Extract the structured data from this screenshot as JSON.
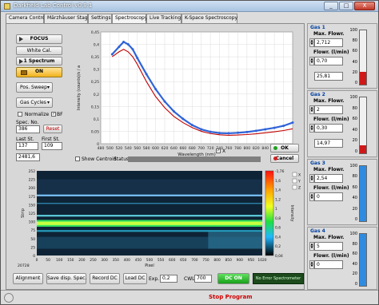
{
  "window": {
    "title": "Darkfield Lab Control v0.8.1",
    "min": "_",
    "max": "□",
    "close": "X"
  },
  "tabs": [
    {
      "label": "Camera Control"
    },
    {
      "label": "Märzhäuser Stage"
    },
    {
      "label": "Settings"
    },
    {
      "label": "Spectroscopy"
    },
    {
      "label": "Live Tracking"
    },
    {
      "label": "K-Space Spectroscopy"
    }
  ],
  "left": {
    "focus": "FOCUS",
    "white_cal": "White Cal.",
    "one_spectrum": "1 Spectrum",
    "on": "ON",
    "pos_sweep": "Pos. Sweep",
    "gas_cycles": "Gas Cycles",
    "normalize": "Normalize",
    "bf": "BF",
    "spec_no_label": "Spec. No.",
    "spec_no": "386",
    "reset": "Reset",
    "last_st_label": "Last St.",
    "first_st_label": "First St.",
    "last_st": "137",
    "first_st": "109",
    "value_2481": "2481,6"
  },
  "spectrum_plot": {
    "show_centroid": "Show Centroid",
    "status": "Status",
    "legend_x": "X",
    "ok": "OK",
    "cancel": "Cancel"
  },
  "chart_data": [
    {
      "type": "line",
      "xlabel": "Wavelength (nm)",
      "ylabel": "Intensity (counts)/s / a",
      "xlim": [
        480,
        900
      ],
      "ylim": [
        0,
        0.45
      ],
      "xticks": [
        "480",
        "500",
        "520",
        "540",
        "560",
        "580",
        "600",
        "620",
        "640",
        "660",
        "680",
        "700",
        "720",
        "740",
        "760",
        "780",
        "800",
        "820",
        "840",
        "860",
        "880",
        "900"
      ],
      "yticks": [
        "0,45",
        "0,4",
        "0,35",
        "0,3",
        "0,25",
        "0,2",
        "0,15",
        "0,1",
        "0,05",
        "0"
      ],
      "series": [
        {
          "color": "#2f63d8",
          "x": [
            505,
            520,
            530,
            540,
            550,
            560,
            580,
            600,
            620,
            640,
            660,
            680,
            700,
            720,
            740,
            760,
            780,
            800,
            820,
            840,
            860,
            880,
            900
          ],
          "y": [
            0.36,
            0.39,
            0.41,
            0.4,
            0.38,
            0.345,
            0.28,
            0.22,
            0.17,
            0.13,
            0.1,
            0.075,
            0.058,
            0.048,
            0.043,
            0.042,
            0.044,
            0.047,
            0.052,
            0.058,
            0.064,
            0.072,
            0.085
          ]
        },
        {
          "color": "#c00000",
          "x": [
            505,
            520,
            530,
            540,
            550,
            560,
            580,
            600,
            620,
            640,
            660,
            680,
            700,
            720,
            740,
            760,
            780,
            800,
            820,
            840,
            860,
            880,
            900
          ],
          "y": [
            0.35,
            0.37,
            0.38,
            0.37,
            0.35,
            0.32,
            0.25,
            0.19,
            0.145,
            0.11,
            0.085,
            0.065,
            0.05,
            0.041,
            0.036,
            0.034,
            0.035,
            0.037,
            0.04,
            0.044,
            0.048,
            0.053,
            0.06
          ]
        }
      ]
    },
    {
      "type": "heatmap",
      "xlabel": "Pixel",
      "ylabel": "Strip",
      "colorbar_label": "Intensity",
      "xticks": [
        "0",
        "50",
        "100",
        "150",
        "200",
        "250",
        "300",
        "350",
        "400",
        "450",
        "500",
        "550",
        "600",
        "650",
        "700",
        "750",
        "800",
        "850",
        "900",
        "950",
        "1020"
      ],
      "yticks": [
        "252",
        "225",
        "200",
        "175",
        "150",
        "125",
        "100",
        "75",
        "50",
        "25",
        "0"
      ],
      "colorbar_ticks": [
        "-1,76",
        "1,6",
        "1,4",
        "1,2",
        "1",
        "0,8",
        "0,6",
        "0,4",
        "0,2",
        "0,04"
      ],
      "bottom_left": "20728",
      "axis_labels": [
        "X",
        "Y",
        "Z"
      ]
    }
  ],
  "bottom": {
    "alignment": "Alignment",
    "save_disp": "Save disp. Spec.",
    "record_dc": "Record DC",
    "load_dc": "Load DC",
    "exp_t_label": "Exp. T",
    "exp_t": "0,2",
    "cwl_label": "CWL",
    "cwl": "700",
    "dc_on": "DC ON",
    "no_error": "No Error Spectrometer"
  },
  "gases": [
    {
      "title": "Gas 1",
      "max_label": "Max. Flowr.",
      "max": "2,712",
      "flow_label": "Flowr. (l/min)",
      "flow": "0,70",
      "value": "25,81",
      "scale": [
        "100",
        "80",
        "60",
        "40",
        "20",
        "0"
      ],
      "fill": 0.24,
      "fill_color": "#d01818"
    },
    {
      "title": "Gas 2",
      "max_label": "Max. Flowr.",
      "max": "2",
      "flow_label": "Flowr. (l/min)",
      "flow": "0,30",
      "value": "14,97",
      "scale": [
        "100",
        "80",
        "60",
        "40",
        "20",
        "0"
      ],
      "fill": 0.15,
      "fill_color": "#d01818"
    },
    {
      "title": "Gas 3",
      "max_label": "Max. Flowr.",
      "max": "2,54",
      "flow_label": "Flowr. (l/min)",
      "flow": "0",
      "value": "",
      "scale": [
        "100",
        "80",
        "60",
        "40",
        "20",
        "0"
      ],
      "fill": 1.0,
      "fill_color": "#2e8be0"
    },
    {
      "title": "Gas 4",
      "max_label": "Max. Flowr.",
      "max": "5",
      "flow_label": "Flowr. (l/min)",
      "flow": "0",
      "value": "",
      "scale": [
        "100",
        "80",
        "60",
        "40",
        "20",
        "0"
      ],
      "fill": 1.0,
      "fill_color": "#2e8be0"
    }
  ],
  "status": {
    "stop_program": "Stop Program"
  }
}
